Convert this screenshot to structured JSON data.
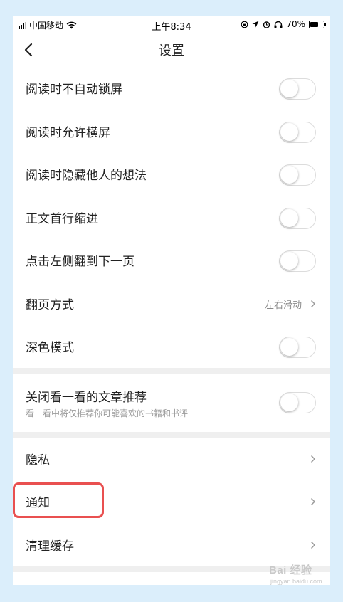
{
  "status_bar": {
    "carrier": "中国移动",
    "time": "上午8:34",
    "battery": "70%",
    "battery_level": 0.7
  },
  "nav": {
    "title": "设置"
  },
  "settings": [
    {
      "label": "阅读时不自动锁屏",
      "type": "toggle",
      "on": false
    },
    {
      "label": "阅读时允许横屏",
      "type": "toggle",
      "on": false
    },
    {
      "label": "阅读时隐藏他人的想法",
      "type": "toggle",
      "on": false
    },
    {
      "label": "正文首行缩进",
      "type": "toggle",
      "on": false
    },
    {
      "label": "点击左侧翻到下一页",
      "type": "toggle",
      "on": false
    },
    {
      "label": "翻页方式",
      "type": "value",
      "value": "左右滑动"
    },
    {
      "label": "深色模式",
      "type": "toggle",
      "on": false
    },
    {
      "label": "关闭看一看的文章推荐",
      "subtitle": "看一看中将仅推荐你可能喜欢的书籍和书评",
      "type": "toggle",
      "on": false
    },
    {
      "label": "隐私",
      "type": "link"
    },
    {
      "label": "通知",
      "type": "link"
    },
    {
      "label": "清理缓存",
      "type": "link"
    }
  ],
  "icons": {
    "back": "chevron-left-icon",
    "arrow": "chevron-right-icon",
    "wifi": "wifi-icon",
    "location": "location-icon",
    "alarm": "alarm-icon",
    "headphones": "headphones-icon"
  },
  "colors": {
    "highlight": "#e95050",
    "background": "#dbeefb"
  },
  "watermark": {
    "text": "Bai 经验",
    "sub": "jingyan.baidu.com"
  }
}
